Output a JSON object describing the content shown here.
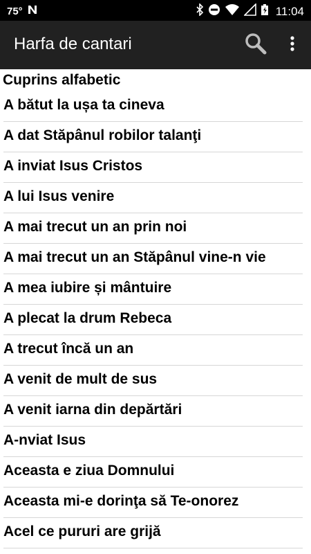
{
  "status_bar": {
    "temperature": "75°",
    "notification_icon": "n-icon",
    "time": "11:04"
  },
  "app_bar": {
    "title": "Harfa de cantari"
  },
  "section": {
    "title": "Cuprins alfabetic"
  },
  "songs": [
    "A bătut la ușa ta cineva",
    "A dat Stăpânul robilor talanţi",
    "A inviat Isus Cristos",
    "A lui Isus venire",
    "A mai trecut un an prin noi",
    "A mai trecut un an Stăpânul vine-n vie",
    "A mea iubire și mântuire",
    "A plecat la drum Rebeca",
    "A trecut încă un an",
    "A venit de mult de sus",
    "A venit iarna din depărtări",
    "A-nviat Isus",
    "Aceasta e ziua Domnului",
    "Aceasta mi-e dorinţa să Te-onorez",
    "Acel ce pururi are grijă"
  ],
  "colors": {
    "app_bar": "#212121",
    "status_bar": "#000000",
    "divider": "#d6d6d6"
  }
}
